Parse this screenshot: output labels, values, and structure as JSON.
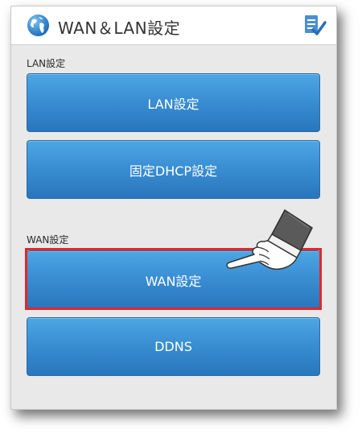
{
  "header": {
    "title": "WAN＆LAN設定",
    "globe_icon": "globe-icon",
    "edit_icon": "edit-check-icon"
  },
  "sections": {
    "lan": {
      "label": "LAN設定",
      "buttons": [
        "LAN設定",
        "固定DHCP設定"
      ]
    },
    "wan": {
      "label": "WAN設定",
      "buttons": [
        "WAN設定",
        "DDNS"
      ]
    }
  },
  "colors": {
    "button_blue": "#3a8fd3",
    "highlight_red": "#e3262a"
  },
  "annotation": {
    "pointer_icon": "pointing-hand-icon",
    "highlighted_button": "WAN設定"
  }
}
